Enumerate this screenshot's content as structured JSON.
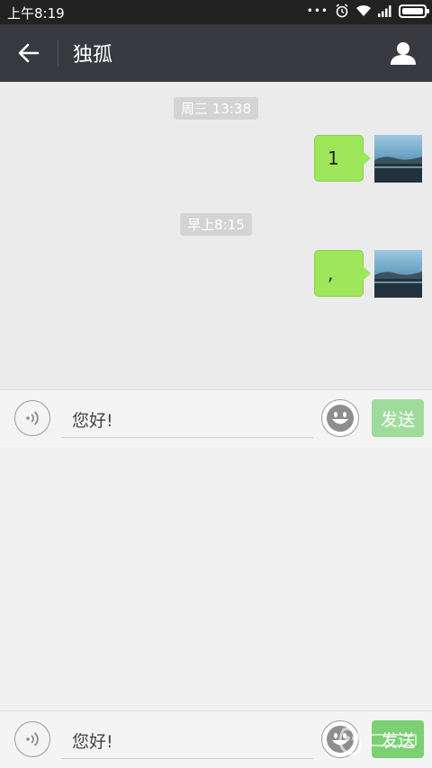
{
  "status_bar": {
    "time": "上午8:19",
    "dots": "•••"
  },
  "header": {
    "title": "独孤"
  },
  "chat": {
    "timestamps": [
      "周三 13:38",
      "早上8:15"
    ],
    "messages": [
      {
        "text": "1"
      },
      {
        "text": ","
      }
    ]
  },
  "input_bar": {
    "text": "您好!",
    "send_label": "发送"
  },
  "input_bar_duplicate": {
    "text": "您好!",
    "send_label": "发送"
  },
  "colors": {
    "header_bg": "#393a3f",
    "bubble": "#9ee65a",
    "send_disabled": "#9fdc9c",
    "send_active": "#7bd074"
  },
  "icons": [
    "back-arrow-icon",
    "profile-icon",
    "voice-icon",
    "emoji-icon",
    "alarm-icon",
    "wifi-icon",
    "signal-icon",
    "battery-icon"
  ]
}
